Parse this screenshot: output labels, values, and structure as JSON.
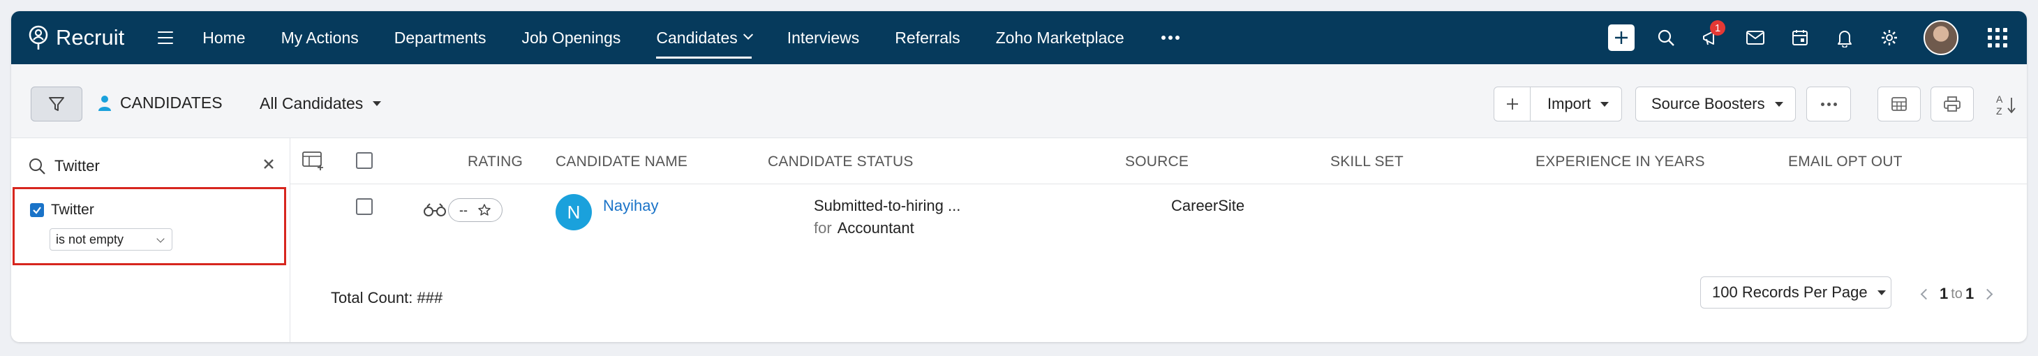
{
  "app": {
    "name": "Recruit",
    "logo_icon": "recruit-logo-icon"
  },
  "nav": {
    "items": [
      {
        "label": "Home",
        "active": false
      },
      {
        "label": "My Actions",
        "active": false
      },
      {
        "label": "Departments",
        "active": false
      },
      {
        "label": "Job Openings",
        "active": false
      },
      {
        "label": "Candidates",
        "active": true,
        "has_dropdown": true
      },
      {
        "label": "Interviews",
        "active": false
      },
      {
        "label": "Referrals",
        "active": false
      },
      {
        "label": "Zoho Marketplace",
        "active": false
      }
    ],
    "notification_count": "1",
    "colors": {
      "nav_bg": "#063a5c",
      "badge": "#e53935",
      "link": "#1a73c8",
      "highlight_border": "#d7261e"
    }
  },
  "toolbar": {
    "module_label": "CANDIDATES",
    "view_label": "All Candidates",
    "import_label": "Import",
    "source_boosters_label": "Source Boosters"
  },
  "filter_panel": {
    "search_value": "Twitter",
    "filter_field": "Twitter",
    "filter_checked": true,
    "condition": "is not empty"
  },
  "table": {
    "headers": {
      "rating": "RATING",
      "candidate_name": "CANDIDATE NAME",
      "candidate_status": "CANDIDATE STATUS",
      "source": "SOURCE",
      "skill_set": "SKILL SET",
      "experience": "EXPERIENCE IN YEARS",
      "email_opt_out": "EMAIL OPT OUT"
    },
    "rows": [
      {
        "rating": "--",
        "initial": "N",
        "name": "Nayihay",
        "status": "Submitted-to-hiring ...",
        "status_for_label": "for",
        "status_job": "Accountant",
        "source": "CareerSite"
      }
    ]
  },
  "footer": {
    "total_count": "Total Count: ###",
    "records_per_page": "100 Records Per Page",
    "page_from": "1",
    "page_to_label": "to",
    "page_to": "1"
  }
}
